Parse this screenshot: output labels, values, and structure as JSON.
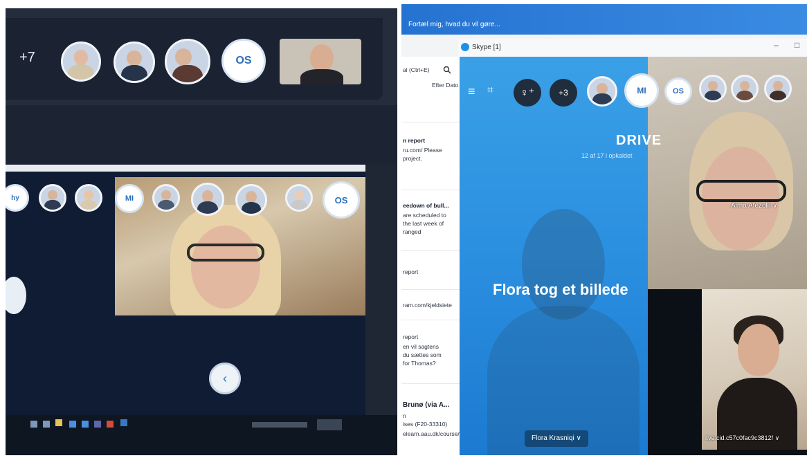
{
  "left_screen": {
    "top_bar": {
      "overflow_count": "+7",
      "initials_avatar": "OS"
    },
    "inner_avatars": [
      "hy",
      "MI",
      "OS"
    ]
  },
  "right_screen": {
    "search_prompt": "Fortæl mig, hvad du vil gøre...",
    "skype_window_title": "Skype [1]",
    "email_pane": {
      "search_partial": "al (Ctrl+E)",
      "filter_label": "Efter Dato",
      "items": [
        {
          "lines": [
            "n report",
            "ru.com/  Please",
            "project."
          ],
          "bold_index": 0
        },
        {
          "lines": [
            "eedown of bull...",
            "are scheduled to",
            "the last week of",
            "ranged"
          ],
          "bold_index": 0
        },
        {
          "lines": [
            "report"
          ],
          "bold_index": -1
        },
        {
          "lines": [
            "ram.com/kjeldsiete"
          ],
          "bold_index": -1
        },
        {
          "lines": [
            "report",
            "en vil sagtens",
            "du sættes som",
            "for Thomas?"
          ],
          "bold_index": -1
        },
        {
          "lines": [
            "Brunø (via A...",
            "n",
            "ises (F20-33310)",
            "elearn.aau.dk/course/vie"
          ],
          "bold_index": 0
        }
      ]
    },
    "call": {
      "overflow_count": "+3",
      "avatar_initials": [
        "MI",
        "OS"
      ],
      "drive_title": "DRIVE",
      "drive_subtitle": "12 af 17 i opkaldet",
      "flora_caption": "Flora tog et billede",
      "flora_name": "Flora Krasniqi",
      "alma_name": "Alma Afezolli",
      "livecid_name": "live:cid.c57c0fac9c3812f"
    }
  },
  "colors": {
    "skype_blue": "#2b8fe0",
    "teams_dark": "#1b2231",
    "avatar_text_blue": "#2a6fbd"
  }
}
